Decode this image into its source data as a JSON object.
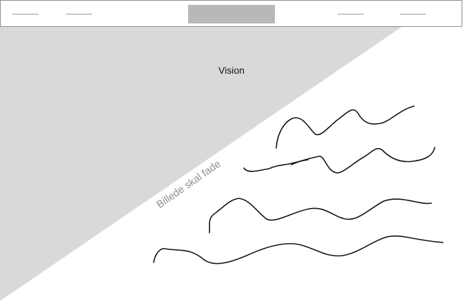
{
  "nav": {
    "links_left": [
      "",
      ""
    ],
    "links_right": [
      "",
      ""
    ],
    "logo": ""
  },
  "hero": {
    "title": "Vision",
    "image_note": "Billede skal fade",
    "triangle_color": "#d9d9d9",
    "sketch_color": "#111111",
    "sketch_lines": 4
  }
}
